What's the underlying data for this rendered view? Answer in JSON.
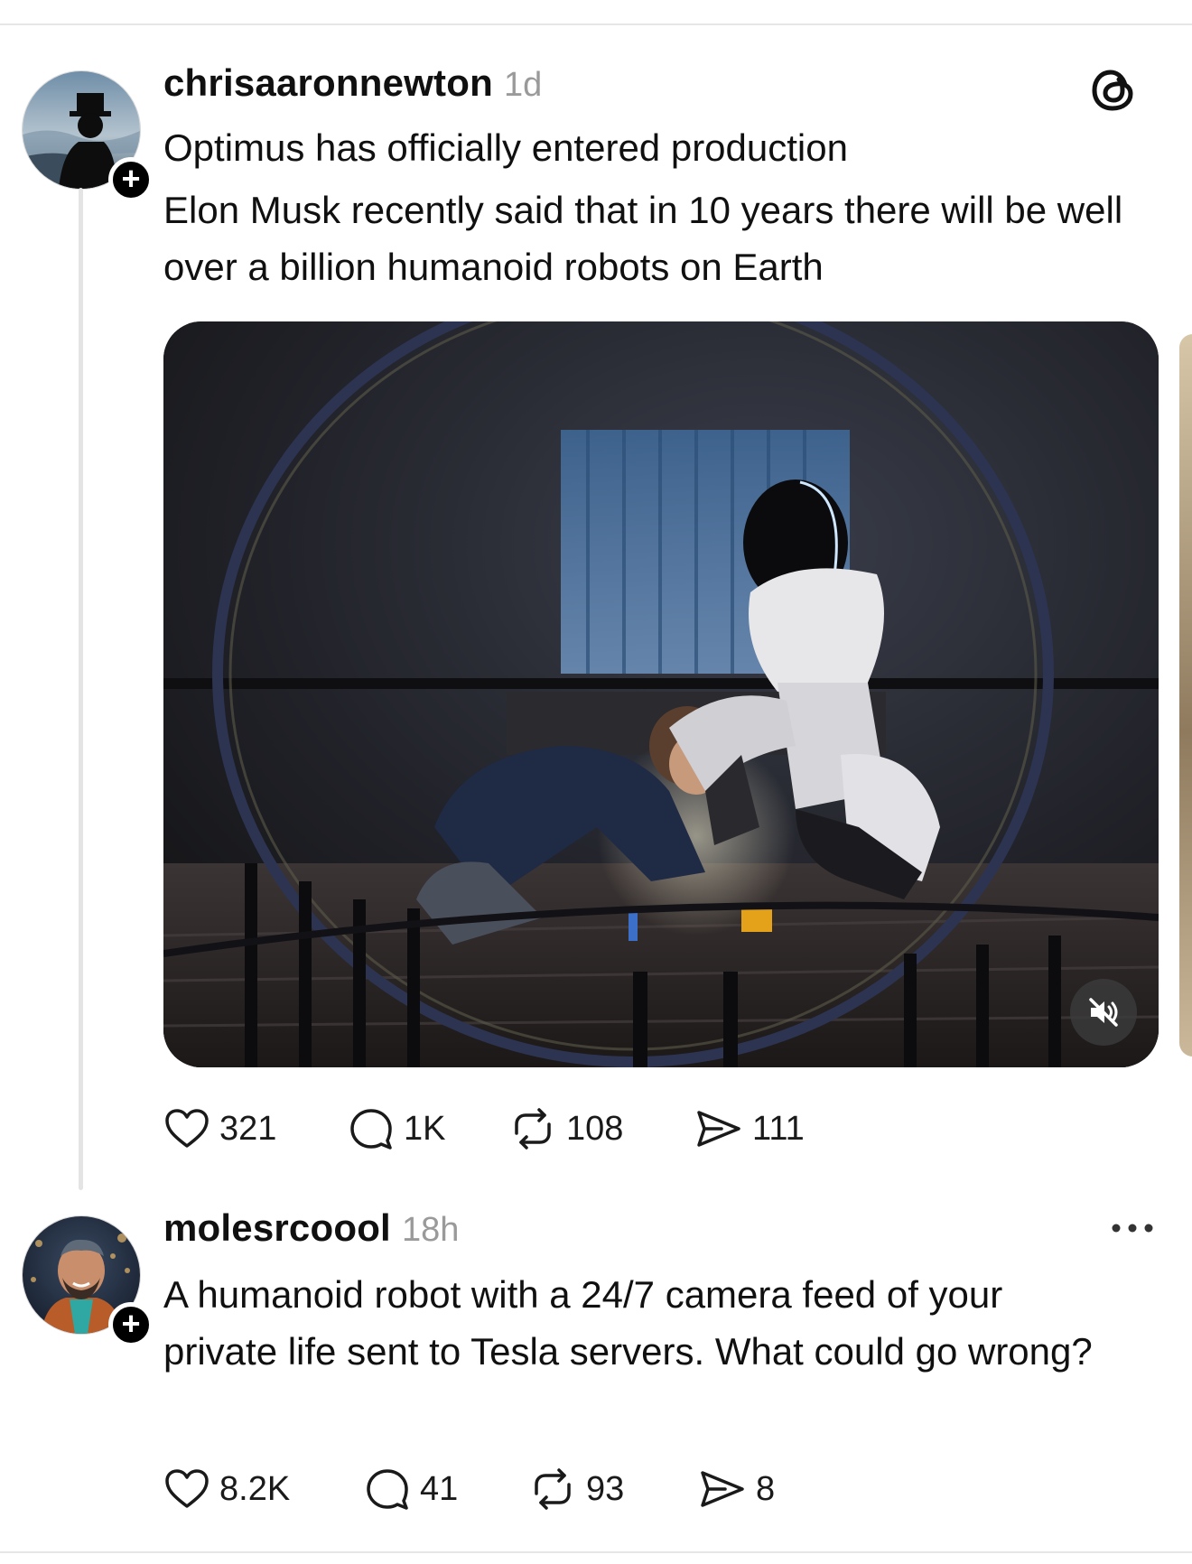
{
  "post1": {
    "username": "chrisaaronnewton",
    "time": "1d",
    "text_line1": "Optimus has officially entered production",
    "text_line2": "Elon Musk recently said that in 10 years there will be well over a billion humanoid robots on Earth",
    "media": {
      "kind": "video",
      "muted": true,
      "scene": "Tesla Optimus robot kneeling beside a boy playing with a toy train set"
    },
    "actions": {
      "likes": "321",
      "replies": "1K",
      "reposts": "108",
      "shares": "111"
    }
  },
  "post2": {
    "username": "molesrcoool",
    "time": "18h",
    "text": "A humanoid robot with a 24/7 camera feed of your private life sent to Tesla servers. What could go wrong?",
    "actions": {
      "likes": "8.2K",
      "replies": "41",
      "reposts": "93",
      "shares": "8"
    }
  },
  "icons": {
    "threads_logo": "threads-logo-icon",
    "follow": "plus-icon",
    "like": "heart-icon",
    "reply": "comment-bubble-icon",
    "repost": "repost-arrows-icon",
    "share": "send-icon",
    "mute": "speaker-muted-icon",
    "more": "more-dots-icon"
  },
  "colors": {
    "text": "#101010",
    "secondary": "#9a9a9a",
    "divider": "#e6e6e6",
    "badge": "#000000"
  }
}
